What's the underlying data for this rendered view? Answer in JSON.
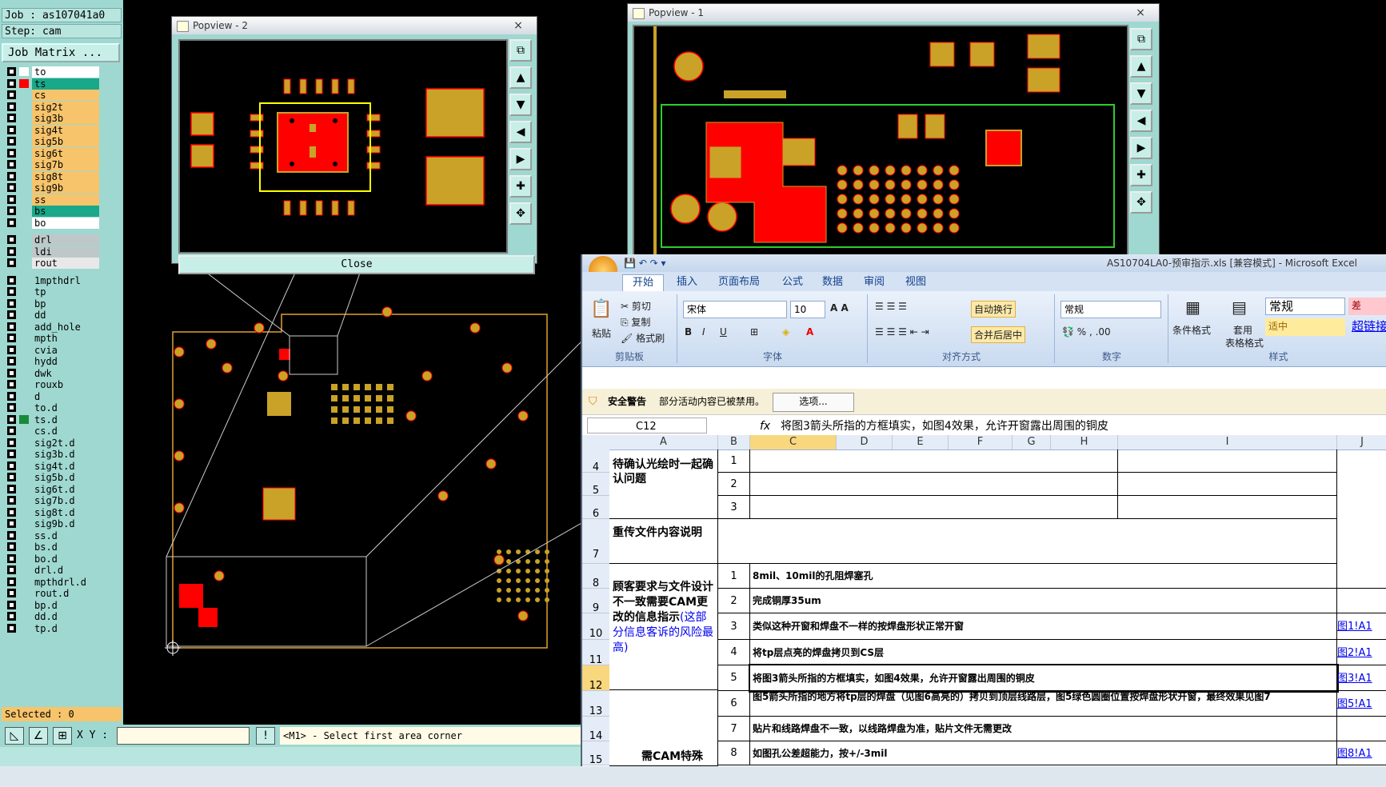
{
  "cam": {
    "job_label": "Job : as107041a0",
    "step_label": "Step: cam",
    "job_matrix_label": "Job Matrix ...",
    "layers": [
      {
        "name": "to",
        "color": "#ffffff",
        "mark": "#ffffff"
      },
      {
        "name": "ts",
        "color": "#1aa88a",
        "mark": "#ff0000"
      },
      {
        "name": "cs",
        "color": "#f7c46b",
        "mark": ""
      },
      {
        "name": "sig2t",
        "color": "#f7c46b",
        "mark": ""
      },
      {
        "name": "sig3b",
        "color": "#f7c46b",
        "mark": ""
      },
      {
        "name": "sig4t",
        "color": "#f7c46b",
        "mark": ""
      },
      {
        "name": "sig5b",
        "color": "#f7c46b",
        "mark": ""
      },
      {
        "name": "sig6t",
        "color": "#f7c46b",
        "mark": ""
      },
      {
        "name": "sig7b",
        "color": "#f7c46b",
        "mark": ""
      },
      {
        "name": "sig8t",
        "color": "#f7c46b",
        "mark": ""
      },
      {
        "name": "sig9b",
        "color": "#f7c46b",
        "mark": ""
      },
      {
        "name": "ss",
        "color": "#f7c46b",
        "mark": ""
      },
      {
        "name": "bs",
        "color": "#1aa88a",
        "mark": ""
      },
      {
        "name": "bo",
        "color": "#ffffff",
        "mark": ""
      },
      {
        "name": "drl",
        "color": "#bfc8c8",
        "mark": ""
      },
      {
        "name": "ldi",
        "color": "#bfc8c8",
        "mark": ""
      },
      {
        "name": "rout",
        "color": "#e8e8e8",
        "mark": ""
      },
      {
        "name": "1mpthdrl",
        "color": "#9fd8d0",
        "mark": ""
      },
      {
        "name": "tp",
        "color": "#9fd8d0",
        "mark": ""
      },
      {
        "name": "bp",
        "color": "#9fd8d0",
        "mark": ""
      },
      {
        "name": "dd",
        "color": "#9fd8d0",
        "mark": ""
      },
      {
        "name": "add_hole",
        "color": "#9fd8d0",
        "mark": ""
      },
      {
        "name": "mpth",
        "color": "#9fd8d0",
        "mark": ""
      },
      {
        "name": "cvia",
        "color": "#9fd8d0",
        "mark": ""
      },
      {
        "name": "hydd",
        "color": "#9fd8d0",
        "mark": ""
      },
      {
        "name": "dwk",
        "color": "#9fd8d0",
        "mark": ""
      },
      {
        "name": "rouxb",
        "color": "#9fd8d0",
        "mark": ""
      },
      {
        "name": "d",
        "color": "#9fd8d0",
        "mark": ""
      },
      {
        "name": "to.d",
        "color": "#9fd8d0",
        "mark": ""
      },
      {
        "name": "ts.d",
        "color": "#9fd8d0",
        "mark": "#1a8a3a"
      },
      {
        "name": "cs.d",
        "color": "#9fd8d0",
        "mark": ""
      },
      {
        "name": "sig2t.d",
        "color": "#9fd8d0",
        "mark": ""
      },
      {
        "name": "sig3b.d",
        "color": "#9fd8d0",
        "mark": ""
      },
      {
        "name": "sig4t.d",
        "color": "#9fd8d0",
        "mark": ""
      },
      {
        "name": "sig5b.d",
        "color": "#9fd8d0",
        "mark": ""
      },
      {
        "name": "sig6t.d",
        "color": "#9fd8d0",
        "mark": ""
      },
      {
        "name": "sig7b.d",
        "color": "#9fd8d0",
        "mark": ""
      },
      {
        "name": "sig8t.d",
        "color": "#9fd8d0",
        "mark": ""
      },
      {
        "name": "sig9b.d",
        "color": "#9fd8d0",
        "mark": ""
      },
      {
        "name": "ss.d",
        "color": "#9fd8d0",
        "mark": ""
      },
      {
        "name": "bs.d",
        "color": "#9fd8d0",
        "mark": ""
      },
      {
        "name": "bo.d",
        "color": "#9fd8d0",
        "mark": ""
      },
      {
        "name": "drl.d",
        "color": "#9fd8d0",
        "mark": ""
      },
      {
        "name": "mpthdrl.d",
        "color": "#9fd8d0",
        "mark": ""
      },
      {
        "name": "rout.d",
        "color": "#9fd8d0",
        "mark": ""
      },
      {
        "name": "bp.d",
        "color": "#9fd8d0",
        "mark": ""
      },
      {
        "name": "dd.d",
        "color": "#9fd8d0",
        "mark": ""
      },
      {
        "name": "tp.d",
        "color": "#9fd8d0",
        "mark": ""
      }
    ],
    "selected_label": "Selected : 0",
    "xy_label": "X Y :",
    "status_message": "<M1> - Select first area corner",
    "popview2_title": "Popview - 2",
    "popview1_title": "Popview - 1",
    "close_label": "Close",
    "close_x": "×"
  },
  "excel": {
    "title": "AS10704LA0-预审指示.xls  [兼容模式] - Microsoft Excel",
    "tabs": [
      "开始",
      "插入",
      "页面布局",
      "公式",
      "数据",
      "审阅",
      "视图"
    ],
    "clipboard": {
      "paste": "粘贴",
      "cut": "剪切",
      "copy": "复制",
      "format_painter": "格式刷",
      "label": "剪贴板"
    },
    "font": {
      "name": "宋体",
      "size": "10",
      "label": "字体"
    },
    "align": {
      "wrap": "自动换行",
      "merge": "合并后居中",
      "label": "对齐方式"
    },
    "number": {
      "format": "常规",
      "label": "数字"
    },
    "styles": {
      "cond": "条件格式",
      "table1": "套用",
      "table2": "表格格式",
      "normal": "常规",
      "bad": "差",
      "neutral": "适中",
      "hyperlink": "超链接",
      "label": "样式"
    },
    "security": {
      "title": "安全警告",
      "text": "部分活动内容已被禁用。",
      "options": "选项..."
    },
    "namebox": "C12",
    "fx": "fx",
    "formula": "将图3箭头所指的方框填实，如图4效果，允许开窗露出周围的铜皮",
    "columns": [
      "A",
      "B",
      "C",
      "D",
      "E",
      "F",
      "G",
      "H",
      "I",
      "J"
    ],
    "rows": [
      "4",
      "5",
      "6",
      "7",
      "8",
      "9",
      "10",
      "11",
      "12",
      "13",
      "14",
      "15"
    ],
    "section1": "待确认光绘时一起确认问题",
    "section2": "重传文件内容说明",
    "section3_a": "顾客要求与文件设计不一致需要CAM更改的信息指示",
    "section3_b": "(这部分信息客诉的风险最高)",
    "section4": "需CAM特殊注",
    "items1": [
      "1",
      "2",
      "3"
    ],
    "items3": [
      {
        "n": "1",
        "text": "8mil、10mil的孔阻焊塞孔",
        "link": ""
      },
      {
        "n": "2",
        "text": "完成铜厚35um",
        "link": ""
      },
      {
        "n": "3",
        "text": "类似这种开窗和焊盘不一样的按焊盘形状正常开窗",
        "link": "图1!A1"
      },
      {
        "n": "4",
        "text": "将tp层点亮的焊盘拷贝到CS层",
        "link": "图2!A1"
      },
      {
        "n": "5",
        "text": "将图3箭头所指的方框填实，如图4效果，允许开窗露出周围的铜皮",
        "link": "图3!A1"
      }
    ],
    "items4": [
      {
        "n": "6",
        "text": "图5箭头所指的地方将tp层的焊盘（见图6高亮的）拷贝到顶层线路层，图5绿色圆圈位置按焊盘形状开窗，最终效果见图7",
        "link": "图5!A1"
      },
      {
        "n": "7",
        "text": "贴片和线路焊盘不一致，以线路焊盘为准，贴片文件无需更改",
        "link": ""
      },
      {
        "n": "8",
        "text": "如图孔公差超能力，按+/-3mil",
        "link": "图8!A1"
      }
    ]
  }
}
